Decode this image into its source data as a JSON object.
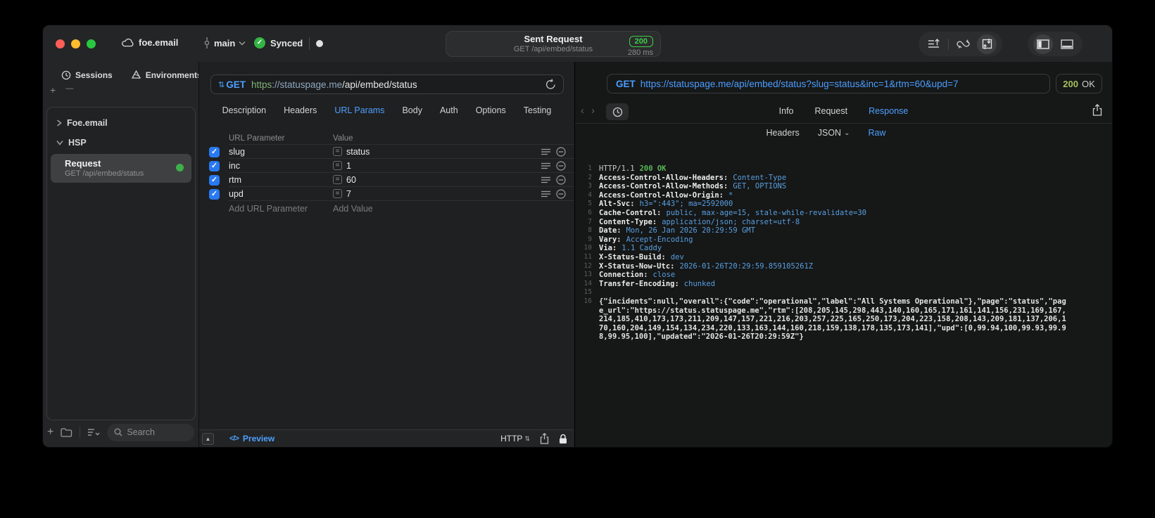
{
  "colors": {
    "accent_blue": "#4da0ff",
    "badge_green": "#3ecf4a",
    "status_green": "#a6c15c",
    "checkbox_blue": "#2979f2",
    "light_close": "#ff5f57",
    "light_min": "#febc2e",
    "light_zoom": "#28c840"
  },
  "icons": {
    "check": "✓",
    "plus": "+",
    "minus": "—",
    "dot": "●",
    "chevron_down": "⌄",
    "chevron_right": "›",
    "back": "‹",
    "forward": "›",
    "collapse_up": "▲",
    "preview_code": "</>",
    "updown": "⇅",
    "equals": "="
  },
  "titlebar": {
    "project": "foe.email",
    "branch": "main",
    "sync_status": "Synced",
    "center": {
      "title": "Sent Request",
      "subtitle": "GET /api/embed/status",
      "status_code": "200",
      "duration": "280 ms"
    }
  },
  "sidebar": {
    "tabs": [
      {
        "label": "Sessions"
      },
      {
        "label": "Environments"
      }
    ],
    "tree": [
      {
        "label": "Foe.email"
      },
      {
        "label": "HSP"
      }
    ],
    "request_item": {
      "title": "Request",
      "subtitle": "GET /api/embed/status"
    },
    "search": {
      "placeholder": "Search"
    }
  },
  "request_panel": {
    "method": "GET",
    "url_scheme": "https",
    "url_host": "://statuspage.me",
    "url_path": "/api/embed/status",
    "tabs": [
      "Description",
      "Headers",
      "URL Params",
      "Body",
      "Auth",
      "Options",
      "Testing"
    ],
    "active_tab": "URL Params",
    "params": {
      "col_param": "URL Parameter",
      "col_value": "Value",
      "rows": [
        {
          "name": "slug",
          "value": "status"
        },
        {
          "name": "inc",
          "value": "1"
        },
        {
          "name": "rtm",
          "value": "60"
        },
        {
          "name": "upd",
          "value": "7"
        }
      ],
      "add_param": "Add URL Parameter",
      "add_value": "Add Value"
    },
    "footer": {
      "preview": "Preview",
      "protocol": "HTTP"
    }
  },
  "response_panel": {
    "method": "GET",
    "url": "https://statuspage.me/api/embed/status?slug=status&inc=1&rtm=60&upd=7",
    "status_code": "200",
    "status_text": "OK",
    "tabs": [
      "Info",
      "Request",
      "Response"
    ],
    "active_tab": "Response",
    "subtabs": [
      "Headers",
      "JSON",
      "Raw"
    ],
    "active_subtab": "Raw",
    "code": {
      "status_line": {
        "num": "1",
        "protocol": "HTTP/1.1",
        "status": "200 OK"
      },
      "headers": [
        {
          "num": "2",
          "name": "Access-Control-Allow-Headers:",
          "value": "Content-Type"
        },
        {
          "num": "3",
          "name": "Access-Control-Allow-Methods:",
          "value": "GET, OPTIONS"
        },
        {
          "num": "4",
          "name": "Access-Control-Allow-Origin:",
          "value": "*"
        },
        {
          "num": "5",
          "name": "Alt-Svc:",
          "value": "h3=\":443\"; ma=2592000"
        },
        {
          "num": "6",
          "name": "Cache-Control:",
          "value": "public, max-age=15, stale-while-revalidate=30"
        },
        {
          "num": "7",
          "name": "Content-Type:",
          "value": "application/json; charset=utf-8"
        },
        {
          "num": "8",
          "name": "Date:",
          "value": "Mon, 26 Jan 2026 20:29:59 GMT"
        },
        {
          "num": "9",
          "name": "Vary:",
          "value": "Accept-Encoding"
        },
        {
          "num": "10",
          "name": "Via:",
          "value": "1.1 Caddy"
        },
        {
          "num": "11",
          "name": "X-Status-Build:",
          "value": "dev"
        },
        {
          "num": "12",
          "name": "X-Status-Now-Utc:",
          "value": "2026-01-26T20:29:59.859105261Z"
        },
        {
          "num": "13",
          "name": "Connection:",
          "value": "close"
        },
        {
          "num": "14",
          "name": "Transfer-Encoding:",
          "value": "chunked"
        }
      ],
      "blank_line_num": "15",
      "body_line": {
        "num": "16",
        "text": "{\"incidents\":null,\"overall\":{\"code\":\"operational\",\"label\":\"All Systems Operational\"},\"page\":\"status\",\"page_url\":\"https://status.statuspage.me\",\"rtm\":[208,205,145,298,443,140,160,165,171,161,141,156,231,169,167,214,185,410,173,173,211,209,147,157,221,216,203,257,225,165,250,173,204,223,158,208,143,209,181,137,206,170,160,204,149,154,134,234,220,133,163,144,160,218,159,138,178,135,173,141],\"upd\":[0,99.94,100,99.93,99.98,99.95,100],\"updated\":\"2026-01-26T20:29:59Z\"}"
      }
    }
  }
}
